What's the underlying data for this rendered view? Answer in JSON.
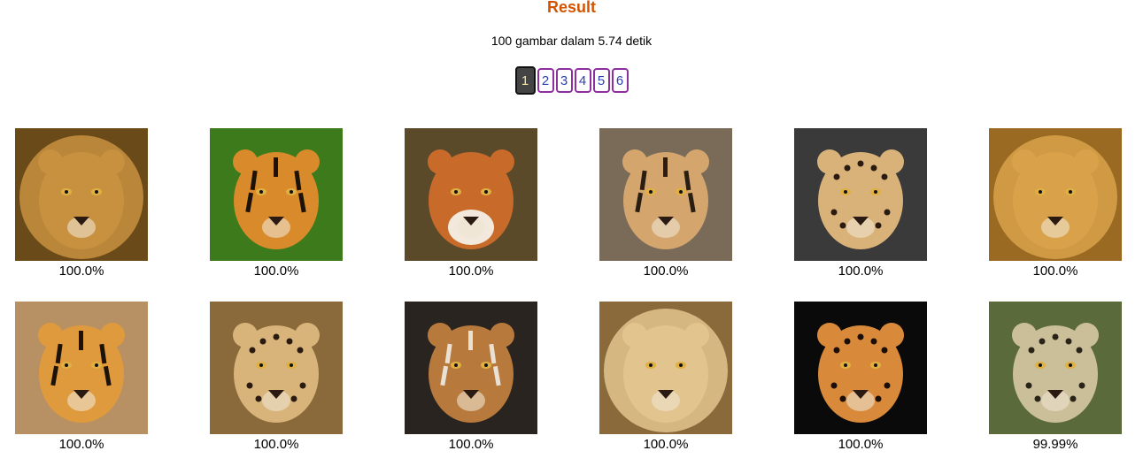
{
  "title": "Result",
  "summary": "100 gambar dalam 5.74 detik",
  "pagination": [
    "1",
    "2",
    "3",
    "4",
    "5",
    "6"
  ],
  "results": [
    {
      "animal": "lion",
      "score": "100.0%",
      "bg": "#6b4a1a",
      "face": "#c8913f",
      "accent": "#3a2408"
    },
    {
      "animal": "tiger",
      "score": "100.0%",
      "bg": "#3d7a1c",
      "face": "#d98a2b",
      "accent": "#1c1208"
    },
    {
      "animal": "fox",
      "score": "100.0%",
      "bg": "#5b4a2a",
      "face": "#c86a2a",
      "accent": "#f2e9dc"
    },
    {
      "animal": "tiger",
      "score": "100.0%",
      "bg": "#7a6a58",
      "face": "#d4a66e",
      "accent": "#2a1d12"
    },
    {
      "animal": "jaguar",
      "score": "100.0%",
      "bg": "#3a3a3a",
      "face": "#d9b279",
      "accent": "#2a1a10"
    },
    {
      "animal": "lion",
      "score": "100.0%",
      "bg": "#9a6a22",
      "face": "#d9a24a",
      "accent": "#4a2e0c"
    },
    {
      "animal": "tiger",
      "score": "100.0%",
      "bg": "#b79063",
      "face": "#e09a3e",
      "accent": "#1c1208"
    },
    {
      "animal": "cheetah",
      "score": "100.0%",
      "bg": "#8a6a3a",
      "face": "#d8b47a",
      "accent": "#2a1a10"
    },
    {
      "animal": "tiger",
      "score": "100.0%",
      "bg": "#2a2420",
      "face": "#b87a3c",
      "accent": "#e9e1d4"
    },
    {
      "animal": "lion",
      "score": "100.0%",
      "bg": "#8a6a3a",
      "face": "#e2c48e",
      "accent": "#3a2a14"
    },
    {
      "animal": "leopard",
      "score": "100.0%",
      "bg": "#0a0a0a",
      "face": "#d88a3a",
      "accent": "#1a0e06"
    },
    {
      "animal": "leopard",
      "score": "99.99%",
      "bg": "#5a6a3a",
      "face": "#cbbf9a",
      "accent": "#2a2418"
    }
  ]
}
